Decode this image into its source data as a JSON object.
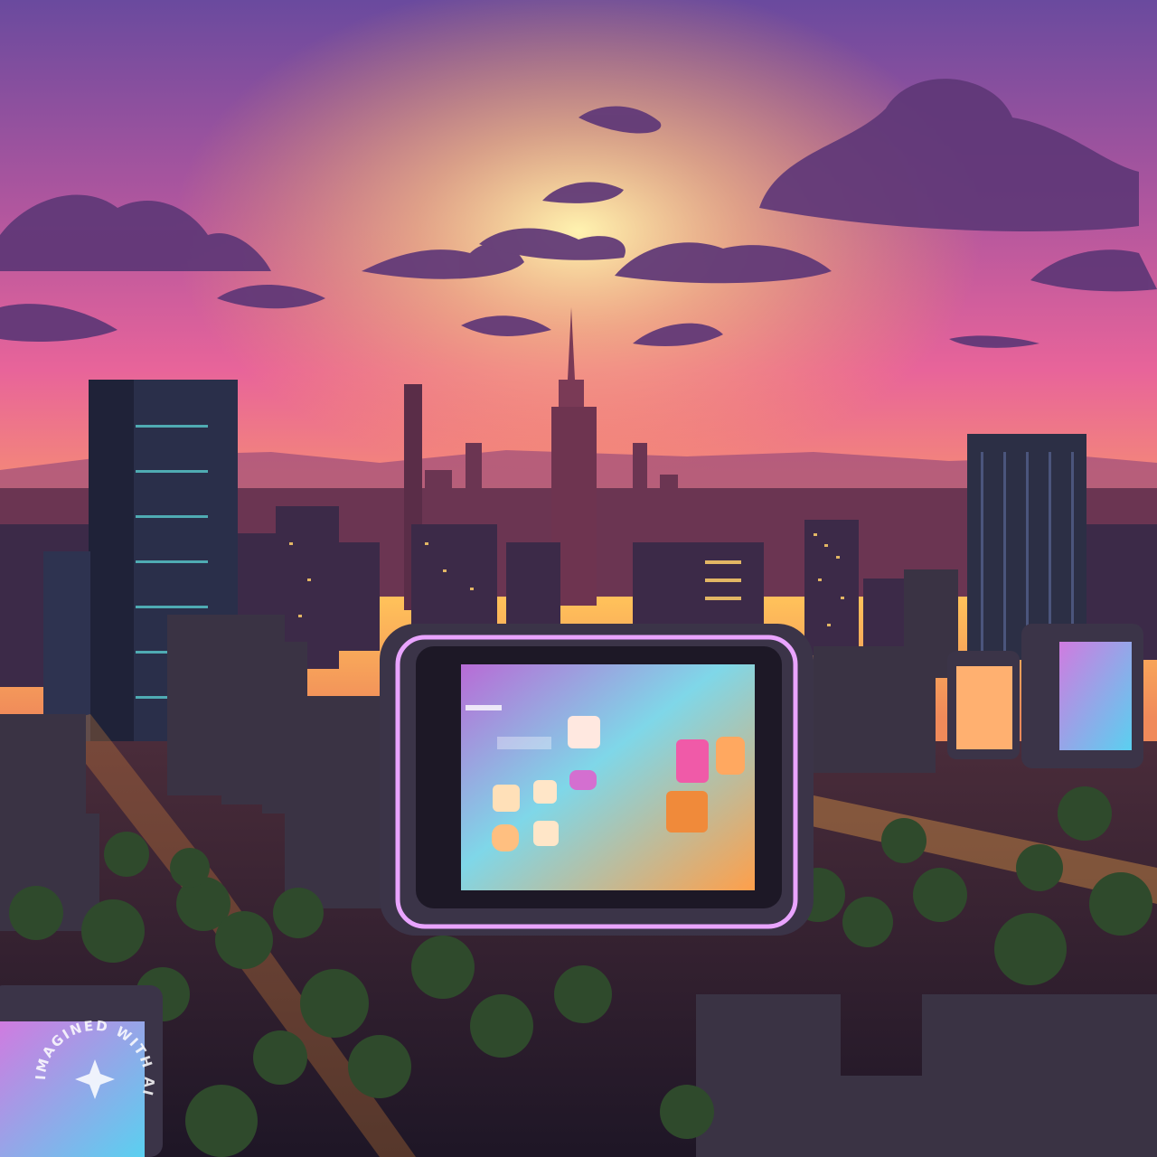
{
  "scene": {
    "description_colors": {
      "sky_top": "#7a4fa0",
      "sky_mid": "#e8609a",
      "sky_horizon": "#ffb347",
      "sun_glow": "#ffe08a",
      "clouds": "#5a3470",
      "buildings": "#2b2540",
      "screen_glow": "#c77dff"
    }
  },
  "watermark": {
    "text": "IMAGINED WITH AI"
  },
  "icons": {
    "billboard": "tablet-billboard-icon",
    "watermark_logo": "sparkle-logo-icon"
  }
}
